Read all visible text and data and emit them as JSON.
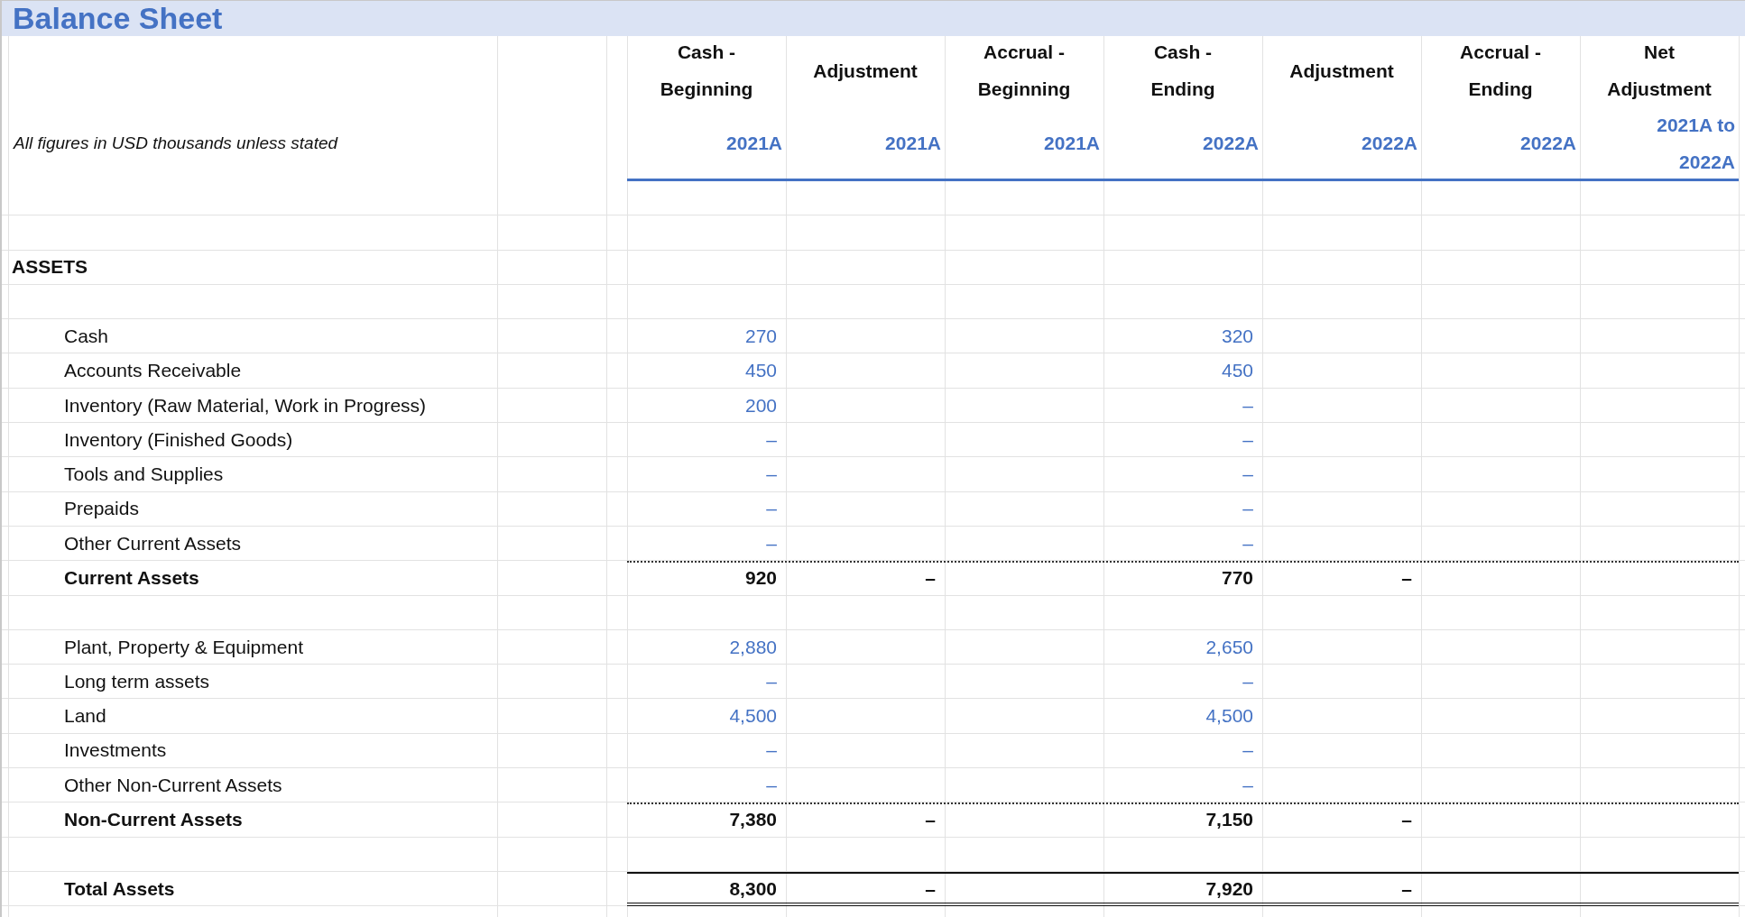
{
  "title": "Balance Sheet",
  "units_note": "All figures in USD thousands unless stated",
  "columns": [
    {
      "label": "Cash - Beginning",
      "period": "2021A"
    },
    {
      "label": "Adjustment",
      "period": "2021A"
    },
    {
      "label": "Accrual - Beginning",
      "period": "2021A"
    },
    {
      "label": "Cash - Ending",
      "period": "2022A"
    },
    {
      "label": "Adjustment",
      "period": "2022A"
    },
    {
      "label": "Accrual - Ending",
      "period": "2022A"
    },
    {
      "label": "Net Adjustment",
      "period": "2021A to 2022A"
    }
  ],
  "rows": [
    {
      "kind": "blank"
    },
    {
      "kind": "blank"
    },
    {
      "kind": "section",
      "label": "ASSETS"
    },
    {
      "kind": "blank"
    },
    {
      "kind": "item",
      "label": "Cash",
      "cells": {
        "cash_beginning": "270",
        "cash_ending": "320"
      }
    },
    {
      "kind": "item",
      "label": "Accounts Receivable",
      "cells": {
        "cash_beginning": "450",
        "cash_ending": "450"
      }
    },
    {
      "kind": "item",
      "label": "Inventory (Raw Material, Work in Progress)",
      "cells": {
        "cash_beginning": "200",
        "cash_ending": "–"
      }
    },
    {
      "kind": "item",
      "label": "Inventory (Finished Goods)",
      "cells": {
        "cash_beginning": "–",
        "cash_ending": "–"
      }
    },
    {
      "kind": "item",
      "label": "Tools and Supplies",
      "cells": {
        "cash_beginning": "–",
        "cash_ending": "–"
      }
    },
    {
      "kind": "item",
      "label": "Prepaids",
      "cells": {
        "cash_beginning": "–",
        "cash_ending": "–"
      }
    },
    {
      "kind": "item",
      "label": "Other Current Assets",
      "cells": {
        "cash_beginning": "–",
        "cash_ending": "–"
      }
    },
    {
      "kind": "subtotal",
      "label": "Current Assets",
      "cells": {
        "cash_beginning": "920",
        "adjustment_2021": "–",
        "cash_ending": "770",
        "adjustment_2022": "–"
      }
    },
    {
      "kind": "blank"
    },
    {
      "kind": "item",
      "label": "Plant, Property & Equipment",
      "cells": {
        "cash_beginning": "2,880",
        "cash_ending": "2,650"
      }
    },
    {
      "kind": "item",
      "label": "Long term assets",
      "cells": {
        "cash_beginning": "–",
        "cash_ending": "–"
      }
    },
    {
      "kind": "item",
      "label": "Land",
      "cells": {
        "cash_beginning": "4,500",
        "cash_ending": "4,500"
      }
    },
    {
      "kind": "item",
      "label": "Investments",
      "cells": {
        "cash_beginning": "–",
        "cash_ending": "–"
      }
    },
    {
      "kind": "item",
      "label": "Other Non-Current Assets",
      "cells": {
        "cash_beginning": "–",
        "cash_ending": "–"
      }
    },
    {
      "kind": "subtotal",
      "label": "Non-Current Assets",
      "cells": {
        "cash_beginning": "7,380",
        "adjustment_2021": "–",
        "cash_ending": "7,150",
        "adjustment_2022": "–"
      }
    },
    {
      "kind": "blank"
    },
    {
      "kind": "total",
      "label": "Total Assets",
      "cells": {
        "cash_beginning": "8,300",
        "adjustment_2021": "–",
        "cash_ending": "7,920",
        "adjustment_2022": "–"
      }
    }
  ]
}
